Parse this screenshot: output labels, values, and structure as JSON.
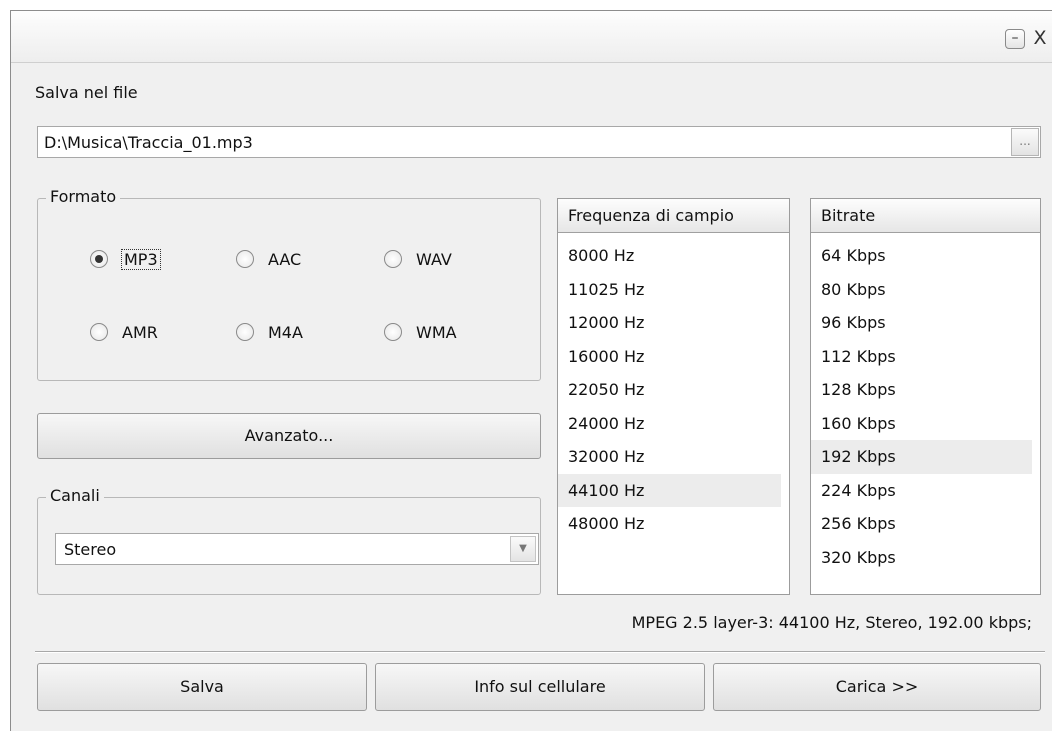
{
  "window": {
    "minimize_glyph": "–",
    "close_glyph": "X"
  },
  "file": {
    "label": "Salva nel file",
    "path": "D:\\Musica\\Traccia_01.mp3",
    "browse_label": "..."
  },
  "format": {
    "title": "Formato",
    "options": [
      {
        "label": "MP3",
        "checked": true
      },
      {
        "label": "AAC",
        "checked": false
      },
      {
        "label": "WAV",
        "checked": false
      },
      {
        "label": "AMR",
        "checked": false
      },
      {
        "label": "M4A",
        "checked": false
      },
      {
        "label": "WMA",
        "checked": false
      }
    ]
  },
  "advanced_label": "Avanzato...",
  "channels": {
    "title": "Canali",
    "value": "Stereo",
    "arrow_glyph": "▼"
  },
  "sample_rate": {
    "header": "Frequenza di campio",
    "items": [
      "8000 Hz",
      "11025 Hz",
      "12000 Hz",
      "16000 Hz",
      "22050 Hz",
      "24000 Hz",
      "32000 Hz",
      "44100 Hz",
      "48000 Hz"
    ],
    "selected": "44100 Hz"
  },
  "bitrate": {
    "header": "Bitrate",
    "items": [
      "64 Kbps",
      "80 Kbps",
      "96 Kbps",
      "112 Kbps",
      "128 Kbps",
      "160 Kbps",
      "192 Kbps",
      "224 Kbps",
      "256 Kbps",
      "320 Kbps"
    ],
    "selected": "192 Kbps"
  },
  "status_text": "MPEG 2.5 layer-3: 44100 Hz,  Stereo, 192.00 kbps;",
  "buttons": {
    "save": "Salva",
    "phone_info": "Info sul cellulare",
    "load": "Carica >>"
  }
}
